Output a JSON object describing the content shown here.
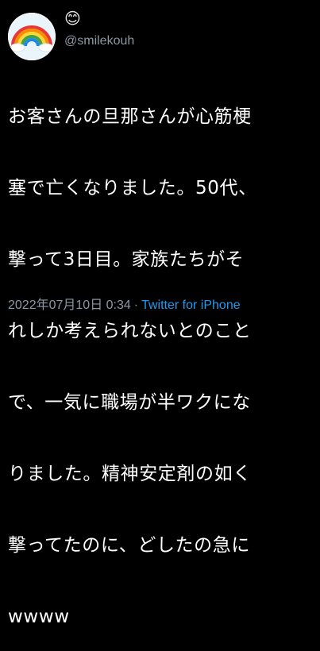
{
  "author": {
    "display_name": "😊",
    "handle": "@smilekouh",
    "avatar_icon": "rainbow-avatar-icon"
  },
  "tweet": {
    "lines": [
      "お客さんの旦那さんが心筋梗",
      "塞で亡くなりました。50代、",
      "撃って3日目。家族たちがそ",
      "れしか考えられないとのこと",
      "で、一気に職場が半ワクにな",
      "りました。精神安定剤の如く",
      "撃ってたのに、どしたの急に",
      "wwww"
    ]
  },
  "meta": {
    "timestamp": "2022年07月10日 0:34",
    "separator": "·",
    "source": "Twitter for iPhone"
  },
  "colors": {
    "background": "#000000",
    "text": "#ffffff",
    "secondary": "#8b98a5",
    "link": "#1d9bf0"
  }
}
